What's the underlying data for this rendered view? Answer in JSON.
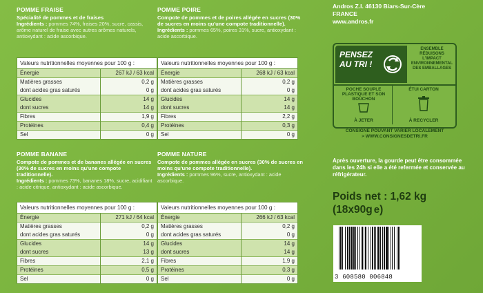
{
  "products": [
    {
      "title": "POMME FRAISE",
      "desc": "Spécialité de pommes et de fraises",
      "ingredients_label": "Ingrédients :",
      "ingredients": "pommes 74%, fraises 20%, sucre, cassis, arôme naturel de fraise avec autres arômes naturels, antioxydant : acide ascorbique.",
      "table": {
        "header": "Valeurs nutritionnelles moyennes pour 100 g :",
        "rows": [
          {
            "label": "Énergie",
            "value": "267 kJ / 63 kcal"
          },
          {
            "label": "Matières grasses",
            "value": "0,2 g"
          },
          {
            "label": "dont acides gras saturés",
            "value": "0 g"
          },
          {
            "label": "Glucides",
            "value": "14 g"
          },
          {
            "label": "dont sucres",
            "value": "14 g"
          },
          {
            "label": "Fibres",
            "value": "1,9 g"
          },
          {
            "label": "Protéines",
            "value": "0,4 g"
          },
          {
            "label": "Sel",
            "value": "0 g"
          }
        ]
      }
    },
    {
      "title": "POMME POIRE",
      "desc": "Compote de pommes et de poires allégée en sucres (30% de sucres en moins qu'une compote traditionnelle).",
      "ingredients_label": "Ingrédients :",
      "ingredients": "pommes 65%, poires 31%, sucre, antioxydant : acide ascorbique.",
      "table": {
        "header": "Valeurs nutritionnelles moyennes pour 100 g :",
        "rows": [
          {
            "label": "Énergie",
            "value": "268 kJ / 63 kcal"
          },
          {
            "label": "Matières grasses",
            "value": "0,2 g"
          },
          {
            "label": "dont acides gras saturés",
            "value": "0 g"
          },
          {
            "label": "Glucides",
            "value": "14 g"
          },
          {
            "label": "dont sucres",
            "value": "14 g"
          },
          {
            "label": "Fibres",
            "value": "2,2 g"
          },
          {
            "label": "Protéines",
            "value": "0,3 g"
          },
          {
            "label": "Sel",
            "value": "0 g"
          }
        ]
      }
    },
    {
      "title": "POMME BANANE",
      "desc": "Compote de pommes et de bananes allégée en sucres (30% de sucres en moins qu'une compote traditionnelle).",
      "ingredients_label": "Ingrédients :",
      "ingredients": "pommes 73%, bananes 18%, sucre, acidifiant : acide citrique, antioxydant : acide ascorbique.",
      "table": {
        "header": "Valeurs nutritionnelles moyennes pour 100 g :",
        "rows": [
          {
            "label": "Énergie",
            "value": "271 kJ / 64 kcal"
          },
          {
            "label": "Matières grasses",
            "value": "0,2 g"
          },
          {
            "label": "dont acides gras saturés",
            "value": "0 g"
          },
          {
            "label": "Glucides",
            "value": "14 g"
          },
          {
            "label": "dont sucres",
            "value": "13 g"
          },
          {
            "label": "Fibres",
            "value": "2,1 g"
          },
          {
            "label": "Protéines",
            "value": "0,5 g"
          },
          {
            "label": "Sel",
            "value": "0 g"
          }
        ]
      }
    },
    {
      "title": "POMME NATURE",
      "desc": "Compote de pommes allégée en sucres (30% de sucres en moins qu'une compote traditionnelle).",
      "ingredients_label": "Ingrédients :",
      "ingredients": "pommes 96%, sucre, antioxydant : acide ascorbique.",
      "table": {
        "header": "Valeurs nutritionnelles moyennes pour 100 g :",
        "rows": [
          {
            "label": "Énergie",
            "value": "266 kJ / 63 kcal"
          },
          {
            "label": "Matières grasses",
            "value": "0,2 g"
          },
          {
            "label": "dont acides gras saturés",
            "value": "0 g"
          },
          {
            "label": "Glucides",
            "value": "14 g"
          },
          {
            "label": "dont sucres",
            "value": "14 g"
          },
          {
            "label": "Fibres",
            "value": "1,9 g"
          },
          {
            "label": "Protéines",
            "value": "0,3 g"
          },
          {
            "label": "Sel",
            "value": "0 g"
          }
        ]
      }
    }
  ],
  "address": {
    "line1": "Andros Z.I. 46130 Biars-Sur-Cère",
    "line2": "FRANCE",
    "line3": "www.andros.fr"
  },
  "recycling": {
    "pensez": "PENSEZ AU TRI !",
    "ensemble": "ENSEMBLE RÉDUISONS L'IMPACT ENVIRONNEMENTAL DES EMBALLAGES",
    "item1_label": "POCHE SOUPLE PLASTIQUE ET SON BOUCHON",
    "item1_action": "À JETER",
    "item2_label": "ÉTUI CARTON",
    "item2_action": "À RECYCLER",
    "consigne1": "CONSIGNE POUVANT VARIER LOCALEMENT",
    "consigne2": "> WWW.CONSIGNESDETRI.FR"
  },
  "conseil": "Après ouverture, la gourde peut être consommée dans les 24h si elle a été refermée et conservée au réfrigérateur.",
  "poids": {
    "line1": "Poids net : 1,62 kg",
    "line2": "(18x90g",
    "estim": "e",
    "close": ")"
  },
  "barcode": "3 608580 006848"
}
